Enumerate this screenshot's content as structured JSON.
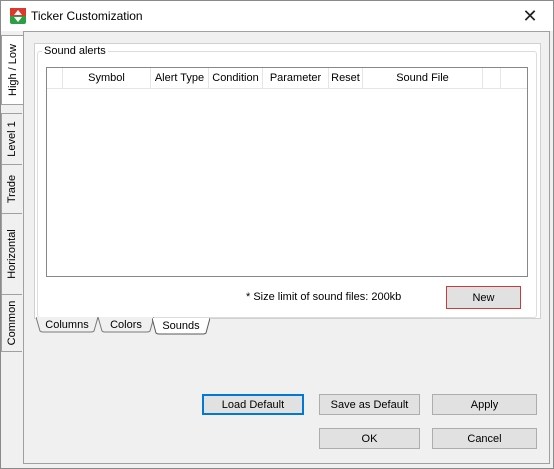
{
  "window": {
    "title": "Ticker Customization"
  },
  "side_tabs": [
    "High / Low",
    "Level 1",
    "Trade",
    "Horizontal",
    "Common"
  ],
  "group": {
    "label": "Sound alerts"
  },
  "grid": {
    "columns": [
      "",
      "Symbol",
      "Alert Type",
      "Condition",
      "Parameter",
      "Reset",
      "Sound File",
      ""
    ]
  },
  "note": "* Size limit of sound files: 200kb",
  "buttons": {
    "new": "New",
    "load_default": "Load Default",
    "save_default": "Save as Default",
    "apply": "Apply",
    "ok": "OK",
    "cancel": "Cancel"
  },
  "bottom_tabs": [
    "Columns",
    "Colors",
    "Sounds"
  ],
  "colors": {
    "accent": "#0078d7",
    "new_border": "#cc3b3b",
    "icon_red": "#d93a2b",
    "icon_green": "#2e9e45"
  }
}
